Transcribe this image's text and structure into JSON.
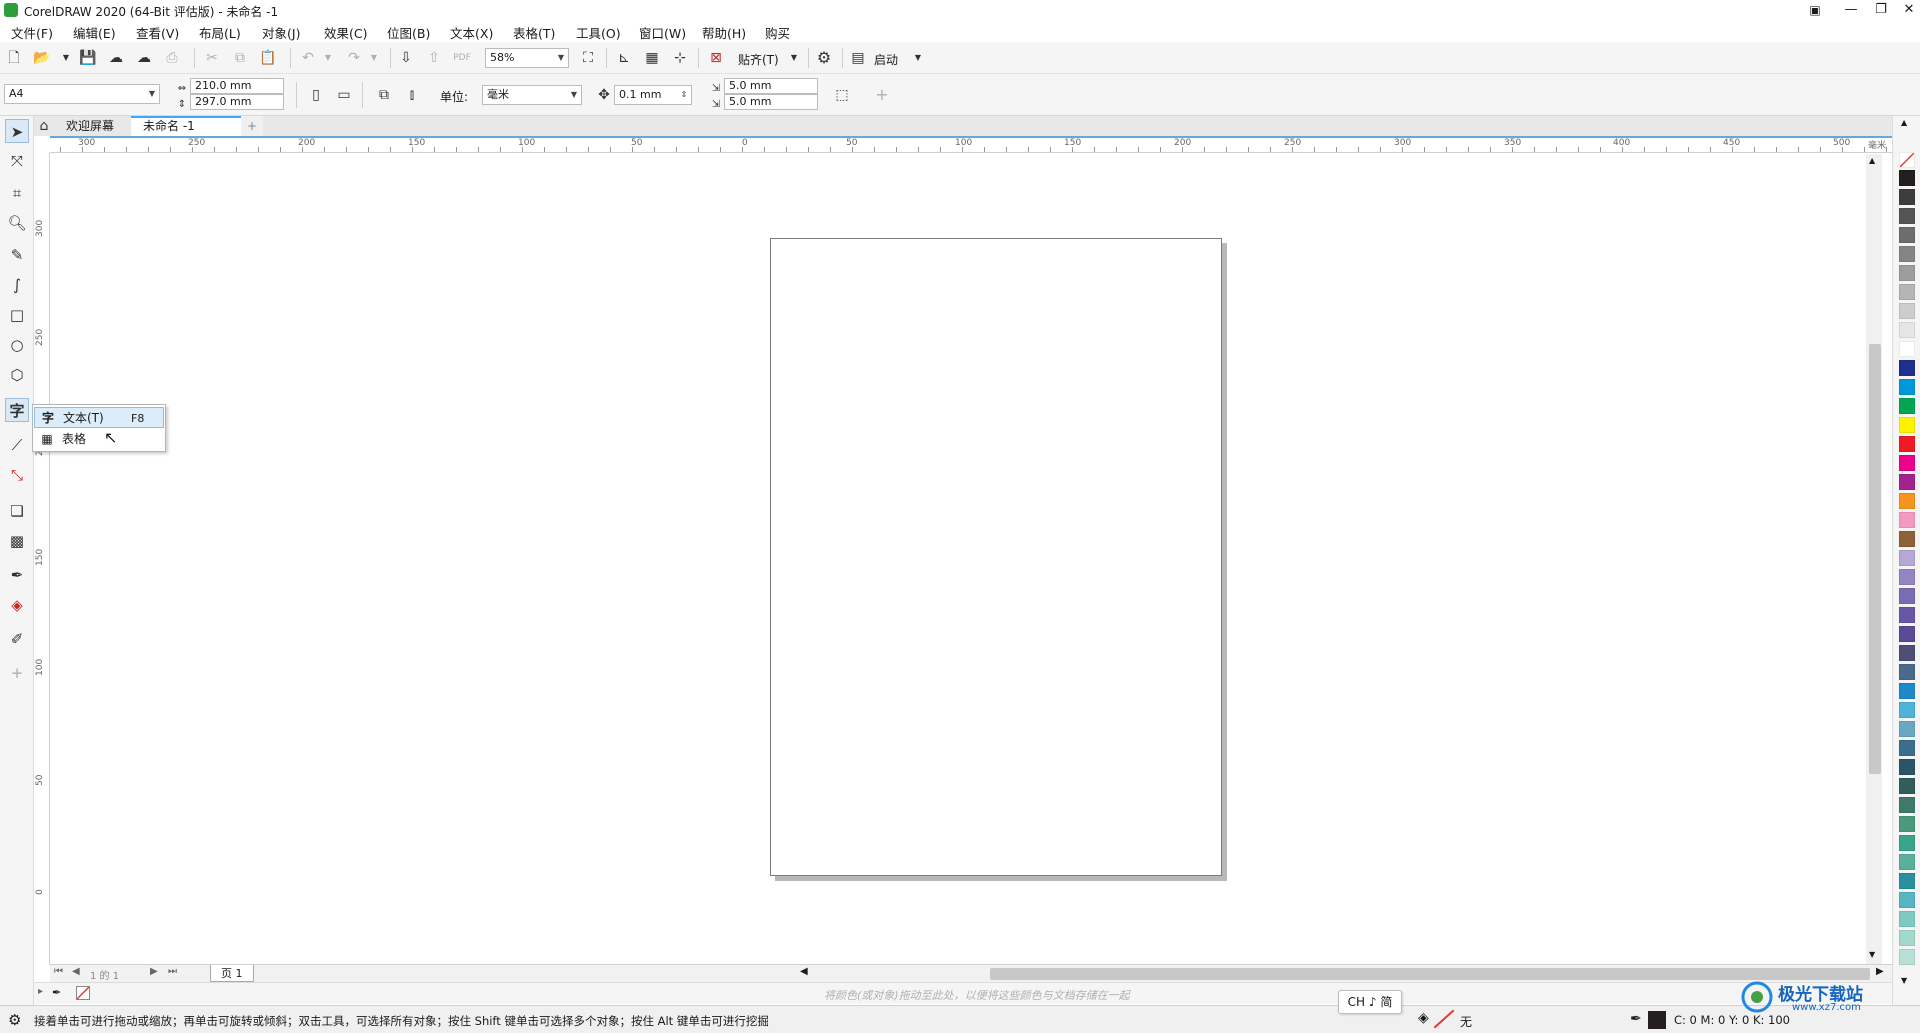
{
  "titlebar": {
    "title": "CorelDRAW 2020 (64-Bit 评估版) - 未命名 -1",
    "buttons": [
      "minimize",
      "restore",
      "close"
    ]
  },
  "menubar": {
    "items": [
      "文件(F)",
      "编辑(E)",
      "查看(V)",
      "布局(L)",
      "对象(J)",
      "效果(C)",
      "位图(B)",
      "文本(X)",
      "表格(T)",
      "工具(O)",
      "窗口(W)",
      "帮助(H)",
      "购买"
    ]
  },
  "toolbar1": {
    "zoom": "58%",
    "snap_label": "贴齐(T)",
    "launch_label": "启动"
  },
  "toolbar2": {
    "page_size": "A4",
    "width": "210.0 mm",
    "height": "297.0 mm",
    "units_label": "单位:",
    "units_value": "毫米",
    "nudge": "0.1 mm",
    "dup_x": "5.0 mm",
    "dup_y": "5.0 mm"
  },
  "tabs": {
    "welcome": "欢迎屏幕",
    "document": "未命名 -1",
    "add": "+"
  },
  "hruler": {
    "labels": [
      "300",
      "250",
      "200",
      "150",
      "100",
      "50",
      "0",
      "50",
      "100",
      "150",
      "200",
      "250",
      "300",
      "350",
      "400",
      "450",
      "500"
    ],
    "unit": "毫米"
  },
  "vruler": {
    "labels": [
      "300",
      "250",
      "200",
      "150",
      "100",
      "50",
      "0"
    ]
  },
  "flyout": {
    "text_icon": "字",
    "text_label": "文本(T)",
    "text_shortcut": "F8",
    "table_label": "表格"
  },
  "pagenav": {
    "counter": "1 的 1",
    "page_tab": "页 1"
  },
  "colordock": {
    "hint": "将颜色(或对象)拖动至此处，以便将这些颜色与文档存储在一起"
  },
  "statusbar": {
    "message": "接着单击可进行拖动或缩放；再单击可旋转或倾斜；双击工具，可选择所有对象；按住 Shift 键单击可选择多个对象；按住 Alt 键单击可进行挖掘",
    "fill_label": "无",
    "cmyk": "C: 0 M: 0 Y: 0 K: 100"
  },
  "ime": {
    "label": "CH ♪ 简"
  },
  "watermark": {
    "text": "极光下载站",
    "url": "www.xz7.com"
  },
  "palette": {
    "colors": [
      "#231f20",
      "#3d3d3d",
      "#555555",
      "#6d6d6d",
      "#858585",
      "#9d9d9d",
      "#b5b5b5",
      "#cdcdcd",
      "#e6e6e6",
      "#ffffff",
      "#1f2f8f",
      "#0098d9",
      "#00a650",
      "#fff200",
      "#ed1c24",
      "#ec008c",
      "#a3238e",
      "#f7941d",
      "#f49ac1",
      "#8c6239",
      "#b7a7d4",
      "#9285c2",
      "#7b6db4",
      "#6758a6",
      "#5a4a97",
      "#4f4f75",
      "#4b6a8b",
      "#1e88c9",
      "#4fb3d9",
      "#6ba7c3",
      "#3b6e8a",
      "#2a5468",
      "#335c5c",
      "#3e7a6a",
      "#4c9a7e",
      "#3aa38c",
      "#5ab09a",
      "#2a8f9f",
      "#57b5c4",
      "#7fc9c2",
      "#a3d8cc",
      "#b9e0d4"
    ]
  },
  "accent": "#42a5f5"
}
